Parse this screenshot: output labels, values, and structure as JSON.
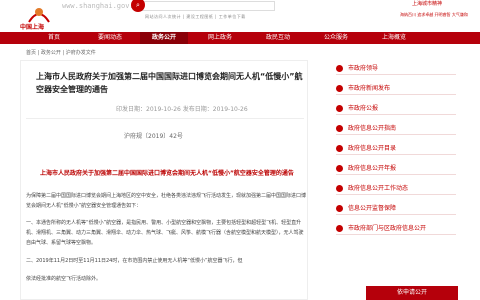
{
  "header": {
    "logo_text": "中国上海",
    "site_url": "www.shanghai.gov.cn",
    "hot_links": "网站访问人次统计 | 建设工程图纸 | 工作单位下载",
    "right_brand": "上海城市精神",
    "right_links": "海纳百川 追求卓越 开明睿智 大气谦和"
  },
  "nav": {
    "items": [
      "首页",
      "要闻动态",
      "政务公开",
      "网上政务",
      "政民互动",
      "公众服务",
      "上海概览"
    ],
    "active_index": 2
  },
  "breadcrumb": "首页 | 政务公开 | 沪府办发文件",
  "article": {
    "title": "上海市人民政府关于加强第二届中国国际进口博览会期间无人机“低慢小”航空器安全管理的通告",
    "meta": "印发日期：2019-10-26    发布日期：2019-10-26",
    "doc_no": "沪府规〔2019〕42号",
    "doc_title": "上海市人民政府关于加强第二届中国国际进口博览会期间无人机“低慢小”航空器安全管理的通告",
    "para1": "为保障第二届中国国际进口博览会期间上海地区的空中安全，杜绝各类违法违规飞行活动发生，现就加强第二届中国国际进口博览会期间无人机“低慢小”航空器安全管理通告如下：",
    "para2": "一、本通告所称的无人机等“低慢小”航空器，是指民用、警用、小型航空器和空飘物，主要包括轻型和超轻型飞机、轻型直升机、滑翔机、三角翼、动力三角翼、滑翔伞、动力伞、热气球、飞艇、风筝、航模飞行器（含航空模型和航天模型），无人驾驶自由气球、系留气球等空飘物。",
    "para3": "二、2019年11月2日时至11月11日24时，在市范围内禁止使用无人机等“低慢小”航空器飞行，但",
    "para4": "依法经批准的航空飞行活动除外。"
  },
  "sidebar": {
    "items": [
      "市政府领导",
      "市政府新闻发布",
      "市政府公报",
      "政府信息公开指南",
      "政府信息公开目录",
      "政府信息公开年报",
      "政府信息公开工作动态",
      "信息公开监督保障",
      "市政府部门与区政府信息公开"
    ],
    "cta": "依申请公开"
  },
  "colors": {
    "brand_red": "#b5000b"
  }
}
